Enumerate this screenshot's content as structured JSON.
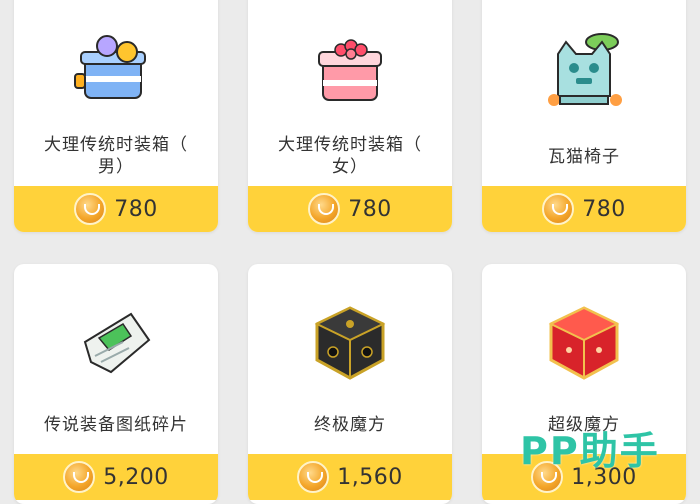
{
  "items": [
    {
      "name": "大理传统时装箱（男）",
      "name_line1": "大理传统时装箱（",
      "name_line2": "男）",
      "price": "780",
      "icon": "blue-fashion-box-icon"
    },
    {
      "name": "大理传统时装箱（女）",
      "name_line1": "大理传统时装箱（",
      "name_line2": "女）",
      "price": "780",
      "icon": "pink-fashion-box-icon"
    },
    {
      "name": "瓦猫椅子",
      "name_line1": "瓦猫椅子",
      "name_line2": "",
      "price": "780",
      "icon": "tile-cat-chair-icon"
    },
    {
      "name": "传说装备图纸碎片",
      "name_line1": "传说装备图纸碎片",
      "name_line2": "",
      "price": "5,200",
      "icon": "blueprint-fragment-icon"
    },
    {
      "name": "终极魔方",
      "name_line1": "终极魔方",
      "name_line2": "",
      "price": "1,560",
      "icon": "black-cube-icon"
    },
    {
      "name": "超级魔方",
      "name_line1": "超级魔方",
      "name_line2": "",
      "price": "1,300",
      "icon": "red-cube-icon"
    }
  ],
  "watermark": "PP助手",
  "colors": {
    "price_bar": "#ffd23a",
    "background": "#ebebeb",
    "watermark": "#2ec4a6"
  }
}
